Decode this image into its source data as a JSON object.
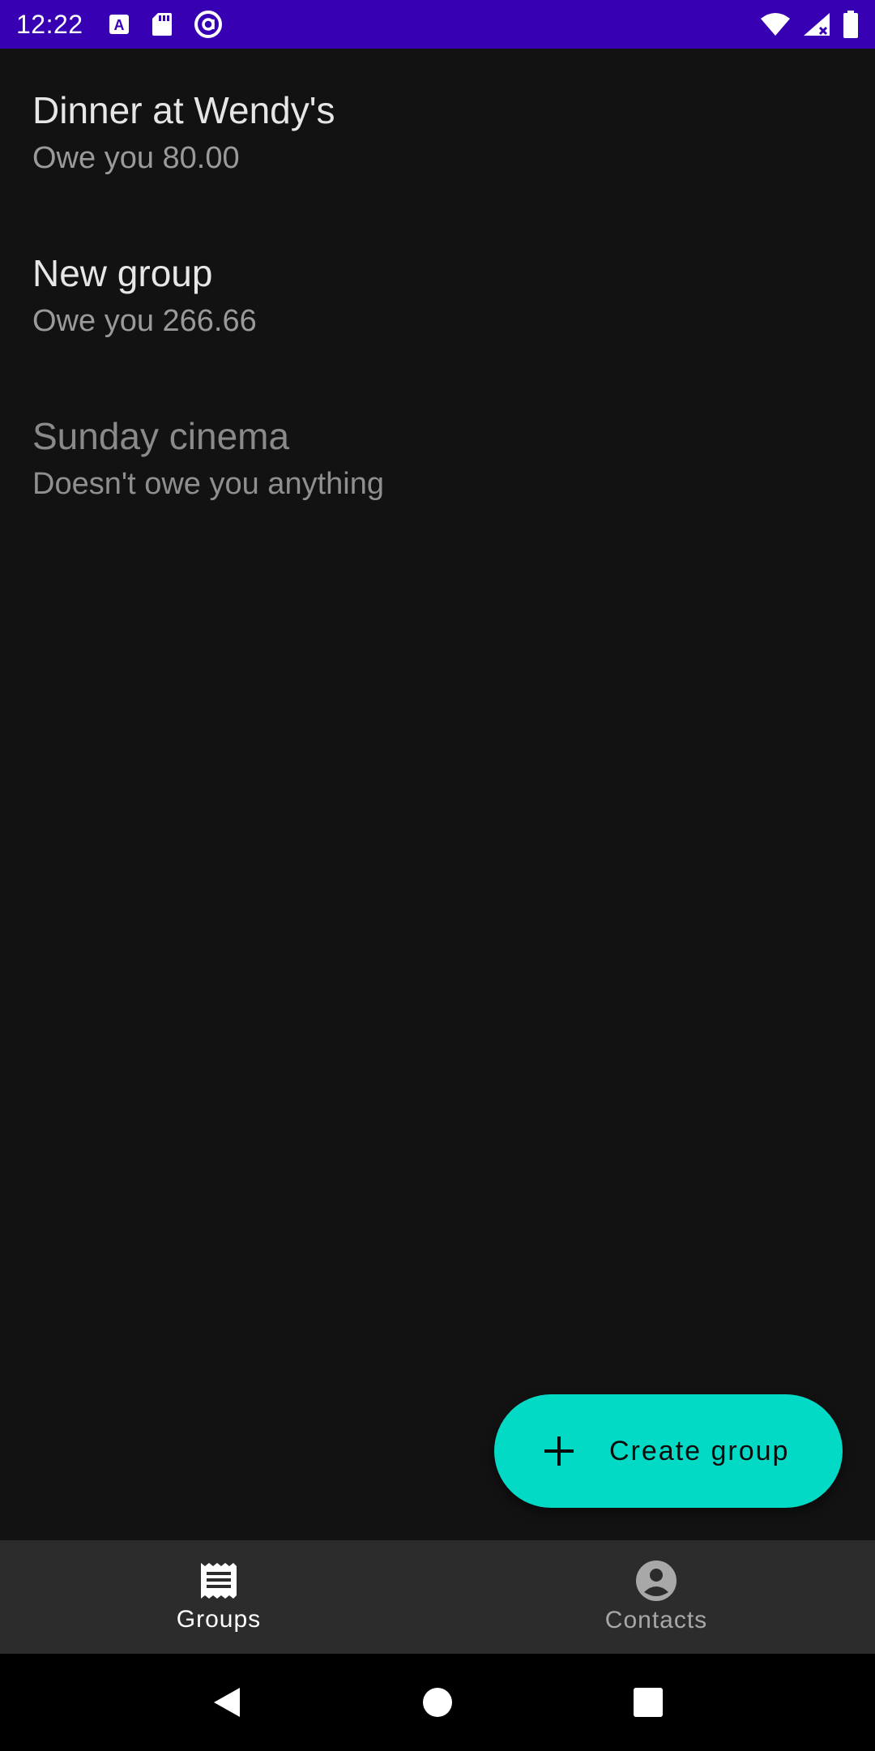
{
  "status_bar": {
    "time": "12:22",
    "left_icons": [
      "a-notification-icon",
      "sd-card-icon",
      "vpn-at-icon"
    ],
    "right_icons": [
      "wifi-icon",
      "signal-icon",
      "battery-icon"
    ],
    "background_color": "#3700b3"
  },
  "groups": [
    {
      "name": "Dinner at Wendy's",
      "balance": "Owe you 80.00",
      "settled": false
    },
    {
      "name": "New group",
      "balance": "Owe you 266.66",
      "settled": false
    },
    {
      "name": "Sunday cinema",
      "balance": "Doesn't owe you anything",
      "settled": true
    }
  ],
  "fab": {
    "label": "Create group",
    "icon": "plus-icon",
    "color": "#03dac5"
  },
  "bottom_nav": {
    "items": [
      {
        "label": "Groups",
        "icon": "receipt-icon",
        "active": true
      },
      {
        "label": "Contacts",
        "icon": "account-circle-icon",
        "active": false
      }
    ]
  },
  "system_nav": {
    "buttons": [
      "back-icon",
      "home-icon",
      "recents-icon"
    ]
  }
}
